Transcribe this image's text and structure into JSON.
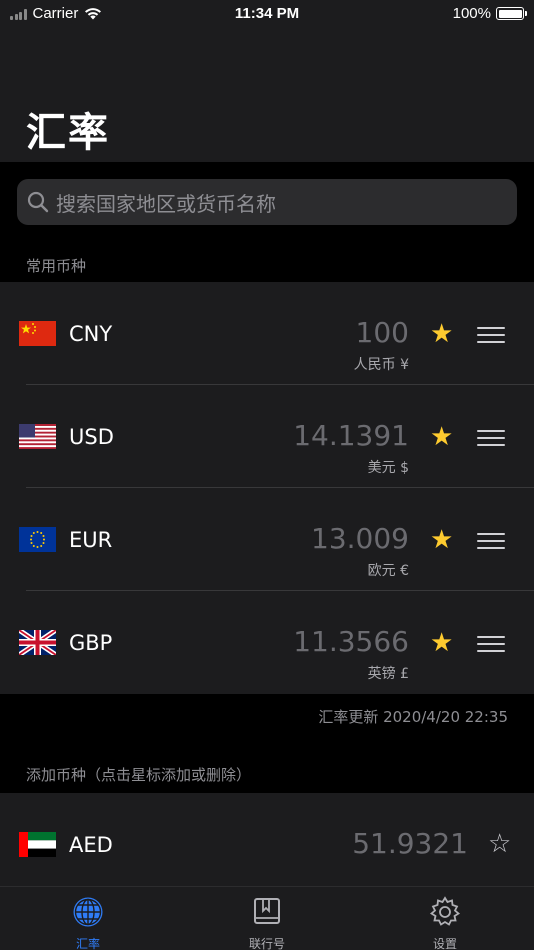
{
  "status_bar": {
    "carrier": "Carrier",
    "time": "11:34 PM",
    "battery": "100%"
  },
  "header": {
    "title": "汇率"
  },
  "search": {
    "placeholder": "搜索国家地区或货币名称"
  },
  "favorites": {
    "section_label": "常用币种",
    "items": [
      {
        "code": "CNY",
        "amount": "100",
        "name": "人民币 ¥",
        "flag": "china-flag",
        "starred": true
      },
      {
        "code": "USD",
        "amount": "14.1391",
        "name": "美元 $",
        "flag": "usa-flag",
        "starred": true
      },
      {
        "code": "EUR",
        "amount": "13.009",
        "name": "欧元 €",
        "flag": "eu-flag",
        "starred": true
      },
      {
        "code": "GBP",
        "amount": "11.3566",
        "name": "英镑 £",
        "flag": "uk-flag",
        "starred": true
      }
    ],
    "update_text": "汇率更新 2020/4/20 22:35"
  },
  "add_section": {
    "section_label": "添加币种（点击星标添加或删除）",
    "items": [
      {
        "code": "AED",
        "amount": "51.9321",
        "flag": "uae-flag",
        "starred": false
      }
    ]
  },
  "tab_bar": {
    "tabs": [
      {
        "label": "汇率",
        "icon": "globe-icon",
        "active": true
      },
      {
        "label": "联行号",
        "icon": "book-icon",
        "active": false
      },
      {
        "label": "设置",
        "icon": "gear-icon",
        "active": false
      }
    ]
  },
  "colors": {
    "accent": "#2f7cf6",
    "star": "#fecb2f",
    "background": "#000000",
    "cell": "#1c1c1e"
  }
}
